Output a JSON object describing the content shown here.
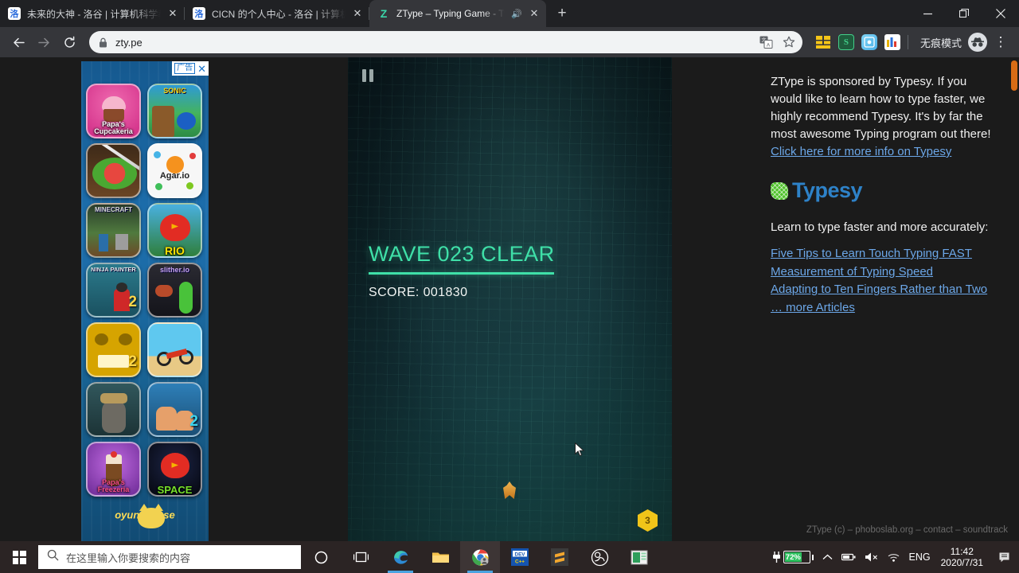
{
  "browser": {
    "tabs": [
      {
        "title": "未来的大神 - 洛谷 | 计算机科学教育新生态",
        "favicon": "luogu-icon",
        "active": false,
        "audio": false
      },
      {
        "title": "CICN 的个人中心 - 洛谷 | 计算机科学教育新生态",
        "favicon": "luogu-icon",
        "active": false,
        "audio": false
      },
      {
        "title": "ZType – Typing Game - Ty",
        "favicon": "ztype-icon",
        "active": true,
        "audio": true
      }
    ],
    "new_tab_label": "+",
    "window_controls": {
      "minimize": "—",
      "restore": "❐",
      "close": "✕"
    },
    "nav": {
      "back": "←",
      "forward": "→",
      "reload": "⟳"
    },
    "omnibox": {
      "url": "zty.pe",
      "lock_icon": "lock-icon",
      "translate_icon": "translate-icon",
      "bookmark_icon": "star-icon"
    },
    "extensions": [
      {
        "name": "grid-extension-icon",
        "label": ""
      },
      {
        "name": "s-extension-icon",
        "label": "S"
      },
      {
        "name": "blue-extension-icon",
        "label": ""
      },
      {
        "name": "chart-extension-icon",
        "label": ""
      }
    ],
    "incognito_label": "无痕模式",
    "menu_icon": "three-dot-menu-icon"
  },
  "ad_panel": {
    "badge_text": "广告",
    "close_label": "✕",
    "thumbs": [
      {
        "name": "papas-cupcakeria",
        "title": "Papa's Cupcakeria"
      },
      {
        "name": "sonic",
        "title": "SONIC"
      },
      {
        "name": "fruit-ninja",
        "title": ""
      },
      {
        "name": "agar-io",
        "title": "Agar.io"
      },
      {
        "name": "minecraft",
        "title": "MINECRAFT"
      },
      {
        "name": "angry-birds-rio",
        "title": "RIO"
      },
      {
        "name": "ninja-painter-2",
        "title": "NINJA PAINTER"
      },
      {
        "name": "slither-io",
        "title": "slither.io"
      },
      {
        "name": "temple-run-2",
        "title": ""
      },
      {
        "name": "moto-x3m",
        "title": ""
      },
      {
        "name": "viking-donkey",
        "title": ""
      },
      {
        "name": "two-player-game",
        "title": ""
      },
      {
        "name": "papas-freezeria",
        "title": "Papa's Freezeria"
      },
      {
        "name": "angry-birds-space",
        "title": "SPACE"
      }
    ],
    "logo_left": "oyun",
    "logo_right": "se"
  },
  "game": {
    "pause_icon": "pause-icon",
    "wave_text": "WAVE 023 CLEAR",
    "score_text": "SCORE: 001830",
    "bomb_count": "3",
    "ship_icon": "player-ship-icon",
    "accent_color": "#3fe0a8",
    "bomb_color": "#f0c419"
  },
  "sponsor": {
    "intro_part1": "ZType is sponsored by Typesy. If you would like to learn how to type faster, we highly recommend Typesy. It's by far the most awesome Typing program out there! ",
    "intro_link": "Click here for more info on Typesy",
    "logo_text": "Typesy",
    "subtitle": "Learn to type faster and more accurately:",
    "links": [
      "Five Tips to Learn Touch Typing FAST",
      "Measurement of Typing Speed",
      "Adapting to Ten Fingers Rather than Two",
      "… more Articles"
    ],
    "link_color": "#6ca7e8",
    "logo_color": "#2e82c8"
  },
  "footer_text": "ZType (c) – phoboslab.org – contact – soundtrack",
  "taskbar": {
    "start_icon": "windows-start-icon",
    "search_placeholder": "在这里输入你要搜索的内容",
    "search_icon": "search-icon",
    "apps": [
      {
        "name": "cortana-icon"
      },
      {
        "name": "task-view-icon"
      },
      {
        "name": "edge-icon"
      },
      {
        "name": "file-explorer-icon"
      },
      {
        "name": "chrome-icon"
      },
      {
        "name": "devcpp-icon",
        "label": "DEV"
      },
      {
        "name": "sublime-text-icon"
      },
      {
        "name": "obs-studio-icon"
      },
      {
        "name": "spreadsheet-icon"
      }
    ],
    "tray": {
      "battery_percent": "72%",
      "charging_icon": "power-plug-icon",
      "chevron_icon": "chevron-up-icon",
      "battery_tray_icon": "battery-icon",
      "volume_icon": "volume-muted-icon",
      "network_icon": "wifi-icon",
      "language": "ENG",
      "time": "11:42",
      "date": "2020/7/31",
      "notification_icon": "notification-icon"
    }
  }
}
